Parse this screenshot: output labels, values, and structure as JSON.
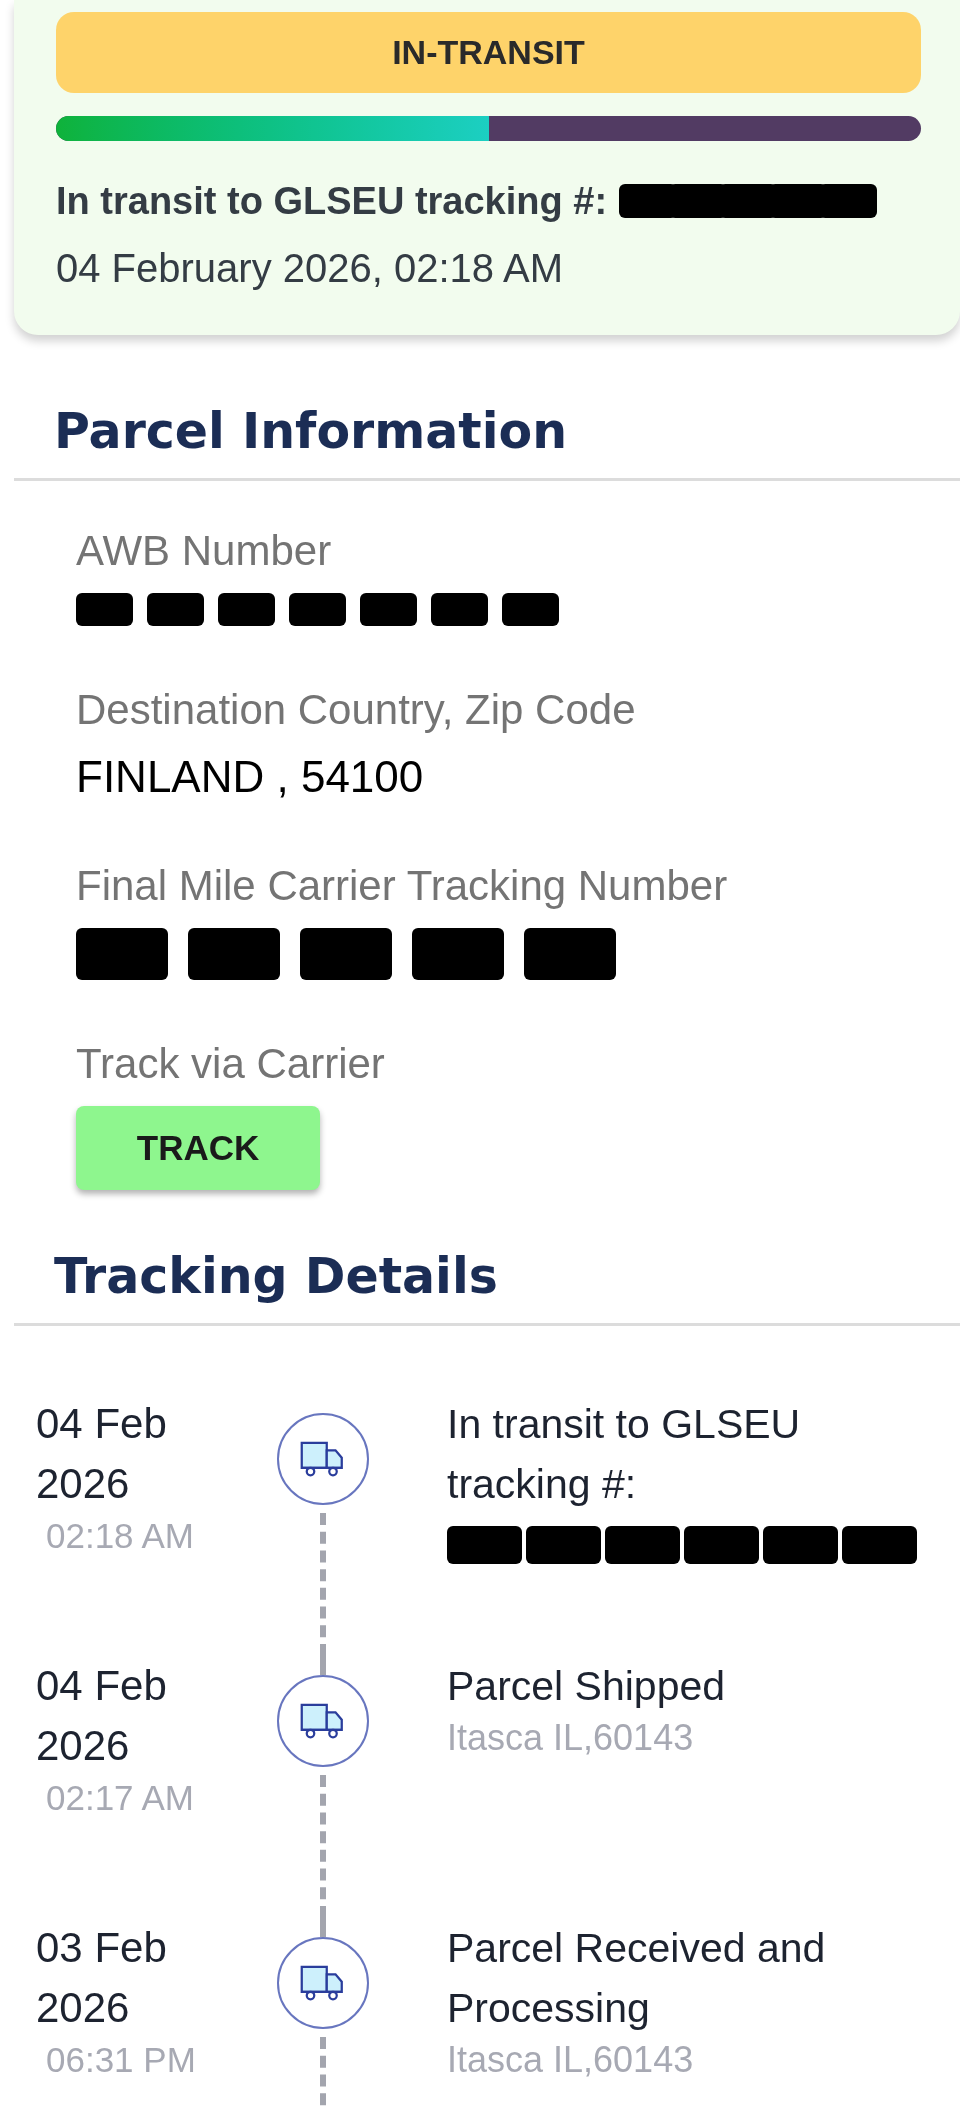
{
  "status_card": {
    "status": "IN-TRANSIT",
    "progress": {
      "level": 0.5
    },
    "message": "In transit to GLSEU tracking #:",
    "message_number": [
      {
        "kind": "redaction"
      },
      {
        "kind": "redaction"
      },
      {
        "kind": "redaction"
      },
      {
        "kind": "redaction"
      },
      {
        "kind": "redaction"
      }
    ],
    "datetime": "04 February 2026, 02:18 AM"
  },
  "parcel_information": {
    "title": "Parcel Information",
    "fields": [
      {
        "label": "AWB Number",
        "kind": "redacted",
        "segments": [
          {
            "kind": "redaction"
          },
          {
            "kind": "redaction"
          },
          {
            "kind": "redaction"
          },
          {
            "kind": "redaction"
          },
          {
            "kind": "redaction"
          },
          {
            "kind": "redaction"
          },
          {
            "kind": "redaction"
          }
        ]
      },
      {
        "label": "Destination Country, Zip Code",
        "kind": "text",
        "value": "FINLAND , 54100"
      },
      {
        "label": "Final Mile Carrier Tracking Number",
        "kind": "redacted",
        "segments": [
          {
            "kind": "redaction"
          },
          {
            "kind": "redaction"
          },
          {
            "kind": "redaction"
          },
          {
            "kind": "redaction"
          },
          {
            "kind": "redaction"
          }
        ]
      },
      {
        "label": "Track via Carrier",
        "kind": "button",
        "value": "TRACK"
      }
    ]
  },
  "tracking_details": {
    "title": "Tracking Details",
    "events": [
      {
        "date": "04 Feb 2026",
        "time": "02:18 AM",
        "title": "In transit to GLSEU tracking #:",
        "segments": [
          {
            "kind": "redaction"
          },
          {
            "kind": "redaction"
          },
          {
            "kind": "redaction"
          },
          {
            "kind": "redaction"
          },
          {
            "kind": "redaction"
          },
          {
            "kind": "redaction"
          }
        ]
      },
      {
        "date": "04 Feb 2026",
        "time": "02:17 AM",
        "title": "Parcel Shipped",
        "location": "Itasca IL,60143"
      },
      {
        "date": "03 Feb 2026",
        "time": "06:31 PM",
        "title": "Parcel Received and Processing",
        "location": "Itasca IL,60143"
      }
    ]
  }
}
